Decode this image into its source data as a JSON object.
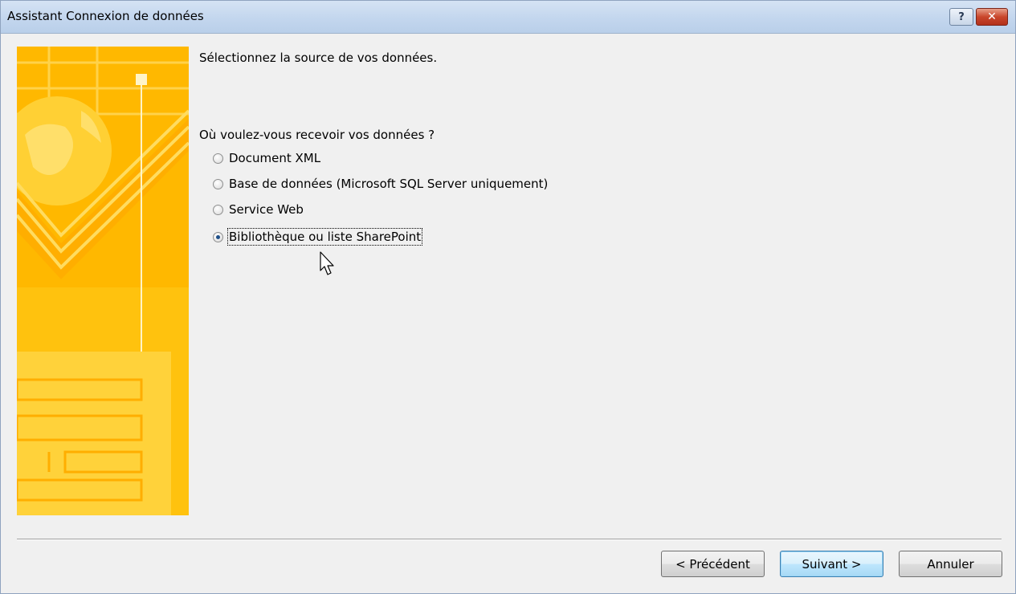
{
  "window": {
    "title": "Assistant Connexion de données",
    "help_glyph": "?",
    "close_glyph": "✕"
  },
  "main": {
    "heading": "Sélectionnez la source de vos données.",
    "question": "Où voulez-vous recevoir vos données ?",
    "options": [
      {
        "label": "Document XML",
        "checked": false
      },
      {
        "label": "Base de données (Microsoft SQL Server uniquement)",
        "checked": false
      },
      {
        "label": "Service Web",
        "checked": false
      },
      {
        "label": "Bibliothèque ou liste SharePoint",
        "checked": true
      }
    ]
  },
  "buttons": {
    "previous": "< Précédent",
    "next": "Suivant >",
    "cancel": "Annuler"
  },
  "colors": {
    "banner": "#ffc20e",
    "titlebar": "#c3d6ee",
    "accent": "#3c7fb1"
  }
}
